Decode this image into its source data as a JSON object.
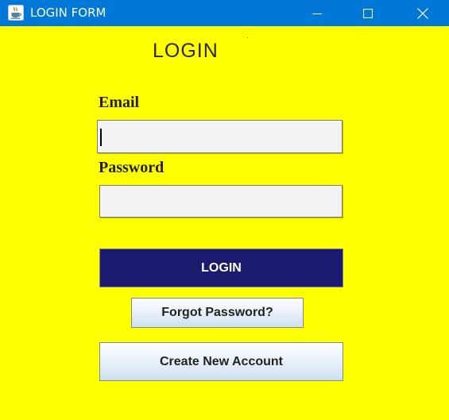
{
  "window": {
    "title": "LOGIN FORM",
    "app_icon": "java-cup-icon",
    "controls": {
      "minimize": "minimize-icon",
      "maximize": "maximize-icon",
      "close": "close-icon"
    }
  },
  "form": {
    "heading": "LOGIN",
    "email_label": "Email",
    "email_value": "",
    "password_label": "Password",
    "password_value": "",
    "login_button": "LOGIN",
    "forgot_button": "Forgot Password?",
    "create_button": "Create New Account"
  },
  "colors": {
    "background": "#ffff00",
    "titlebar": "#0078d7",
    "login_button": "#1b1a6e",
    "text": "#222222"
  }
}
